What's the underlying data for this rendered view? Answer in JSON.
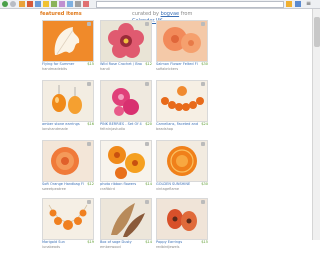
{
  "browser": {
    "menu_glyph": "≡"
  },
  "page": {
    "title": "featured items",
    "curated_prefix": "curated by",
    "curator": "bogvae",
    "from_text": "from",
    "source": "Calendar.UK"
  },
  "items": [
    {
      "title": "Flying for Summer",
      "shop": "handmadebits",
      "price": "$15"
    },
    {
      "title": "Wild Rose Crochet / Brooch",
      "shop": "handi",
      "price": "$12"
    },
    {
      "title": "Salmon Flower Felted Flower",
      "shop": "sofiabrickers",
      "price": "$30"
    },
    {
      "title": "amber stone earrings",
      "shop": "lonshandmade",
      "price": "$16"
    },
    {
      "title": "PINK BERRIES - Set Of 4",
      "shop": "feltninjastudio",
      "price": "$20"
    },
    {
      "title": "Carnelians, Faceted and poly",
      "shop": "beadshop",
      "price": "$24"
    },
    {
      "title": "Soft Orange Handbag Flower",
      "shop": "sweetpeatree",
      "price": "$12"
    },
    {
      "title": "photo ribbon flowers",
      "shop": "craftbird",
      "price": "$14"
    },
    {
      "title": "GOLDEN SUNSHINE",
      "shop": "vintageflame",
      "price": "$30"
    },
    {
      "title": "Marigold Sun",
      "shop": "lunabeads",
      "price": "$19"
    },
    {
      "title": "Box of sage Dusty",
      "shop": "emberwood",
      "price": "$14"
    },
    {
      "title": "Poppy Earrings",
      "shop": "redbirdjewels",
      "price": "$15"
    }
  ]
}
